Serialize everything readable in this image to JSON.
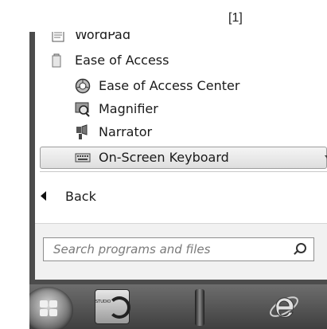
{
  "annotation": "[1]",
  "programs": [
    {
      "label": "WordPad",
      "icon": "wordpad-icon"
    },
    {
      "label": "Ease of Access",
      "icon": "folder-icon"
    },
    {
      "label": "Ease of Access Center",
      "icon": "ease-of-access-center-icon"
    },
    {
      "label": "Magnifier",
      "icon": "magnifier-icon"
    },
    {
      "label": "Narrator",
      "icon": "narrator-icon"
    },
    {
      "label": "On-Screen Keyboard",
      "icon": "keyboard-icon"
    }
  ],
  "back": {
    "label": "Back"
  },
  "search": {
    "placeholder": "Search programs and files"
  },
  "taskbar": {
    "studio_label": "STUDIO",
    "items": [
      "start-orb",
      "studio-app",
      "remote-app",
      "internet-explorer"
    ]
  }
}
